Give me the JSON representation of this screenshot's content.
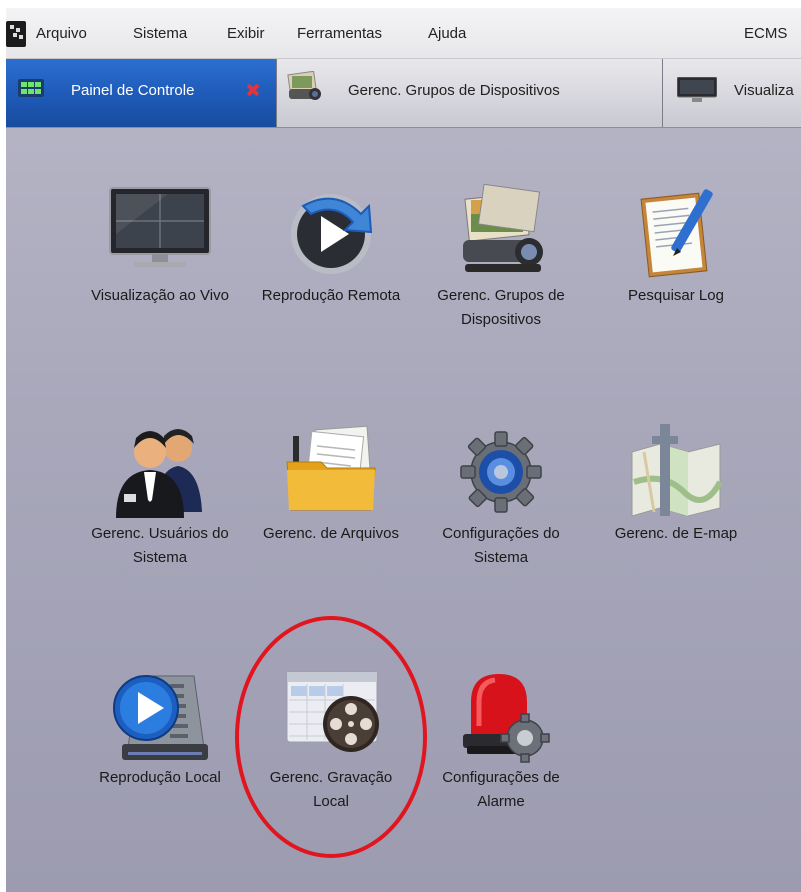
{
  "menubar": {
    "items": [
      "Arquivo",
      "Sistema",
      "Exibir",
      "Ferramentas",
      "Ajuda"
    ],
    "right_label": "ECMS"
  },
  "tabs": [
    {
      "label": "Painel de Controle",
      "active": true
    },
    {
      "label": "Gerenc. Grupos de Dispositivos",
      "active": false
    },
    {
      "label": "Visualiza",
      "active": false
    }
  ],
  "tiles": [
    {
      "label": "Visualização ao Vivo",
      "icon": "monitor-icon"
    },
    {
      "label": "Reprodução Remota",
      "icon": "remote-playback-icon"
    },
    {
      "label": "Gerenc. Grupos de Dispositivos",
      "icon": "device-groups-icon"
    },
    {
      "label": "Pesquisar Log",
      "icon": "log-search-icon"
    },
    {
      "label": "Gerenc. Usuários do Sistema",
      "icon": "users-icon"
    },
    {
      "label": "Gerenc. de Arquivos",
      "icon": "folder-icon"
    },
    {
      "label": "Configurações do Sistema",
      "icon": "system-settings-icon"
    },
    {
      "label": "Gerenc. de E-map",
      "icon": "emap-icon"
    },
    {
      "label": "Reprodução Local",
      "icon": "local-playback-icon"
    },
    {
      "label": "Gerenc. Gravação Local",
      "icon": "local-recording-icon"
    },
    {
      "label": "Configurações de Alarme",
      "icon": "alarm-settings-icon"
    }
  ],
  "colors": {
    "active_tab": "#1e5ab7",
    "background": "#a9a8bb",
    "highlight_circle": "#e1151f"
  }
}
